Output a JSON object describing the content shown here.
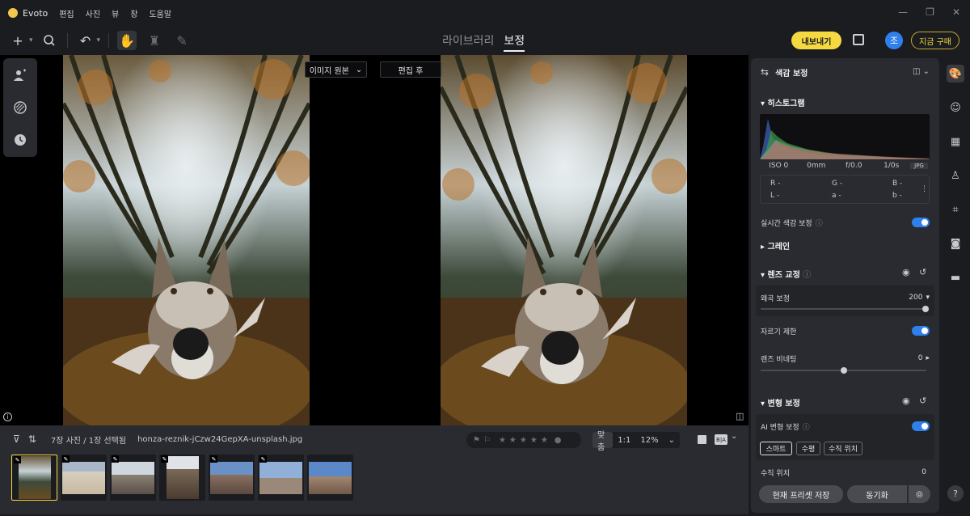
{
  "app": {
    "name": "Evoto",
    "menu": [
      "편집",
      "사진",
      "뷰",
      "창",
      "도움말"
    ]
  },
  "window_controls": [
    "minimize-icon",
    "restore-icon",
    "close-icon"
  ],
  "header": {
    "tabs": {
      "library": "라이브러리",
      "edit": "보정"
    },
    "export_label": "내보내기",
    "avatar_letter": "조",
    "buy_label": "지금 구매"
  },
  "canvas": {
    "original_label": "이미지 원본",
    "after_label": "편집 후"
  },
  "filmbar": {
    "count_text": "7장 사진 / 1장 선택됨",
    "filename": "honza-reznik-jCzw24GepXA-unsplash.jpg",
    "zoom": {
      "fit": "맞춤",
      "one": "1:1",
      "percent": "12%"
    },
    "ba_label": "B|A",
    "thumbnail_count": 7
  },
  "panel": {
    "title": "색감 보정",
    "histogram": {
      "title": "히스토그램",
      "exif": [
        "ISO 0",
        "0mm",
        "f/0.0",
        "1/0s"
      ],
      "format": "JPG",
      "rgb": {
        "r": "R -",
        "g": "G -",
        "b": "B -",
        "l": "L -",
        "a": "a -",
        "b2": "b -"
      }
    },
    "realtime_label": "실시간 색감 보정",
    "grain_title": "그레인",
    "lens": {
      "title": "렌즈 교정",
      "distortion_label": "왜곡 보정",
      "distortion_value": "200",
      "crop_label": "자르기 제한",
      "vignette_label": "렌즈 비네팅",
      "vignette_value": "0"
    },
    "transform": {
      "title": "변형 보정",
      "ai_label": "AI 변형 보정",
      "chips": [
        "스마트",
        "수평",
        "수직 위치"
      ],
      "vertical_label": "수직 위치",
      "vertical_value": "0"
    },
    "save_preset": "현재 프리셋 저장",
    "sync": "동기화"
  },
  "right_rail": [
    "palette-icon",
    "face-icon",
    "eraser-icon",
    "shirt-icon",
    "crop-icon",
    "camera-icon",
    "folder-icon"
  ],
  "help": "?"
}
